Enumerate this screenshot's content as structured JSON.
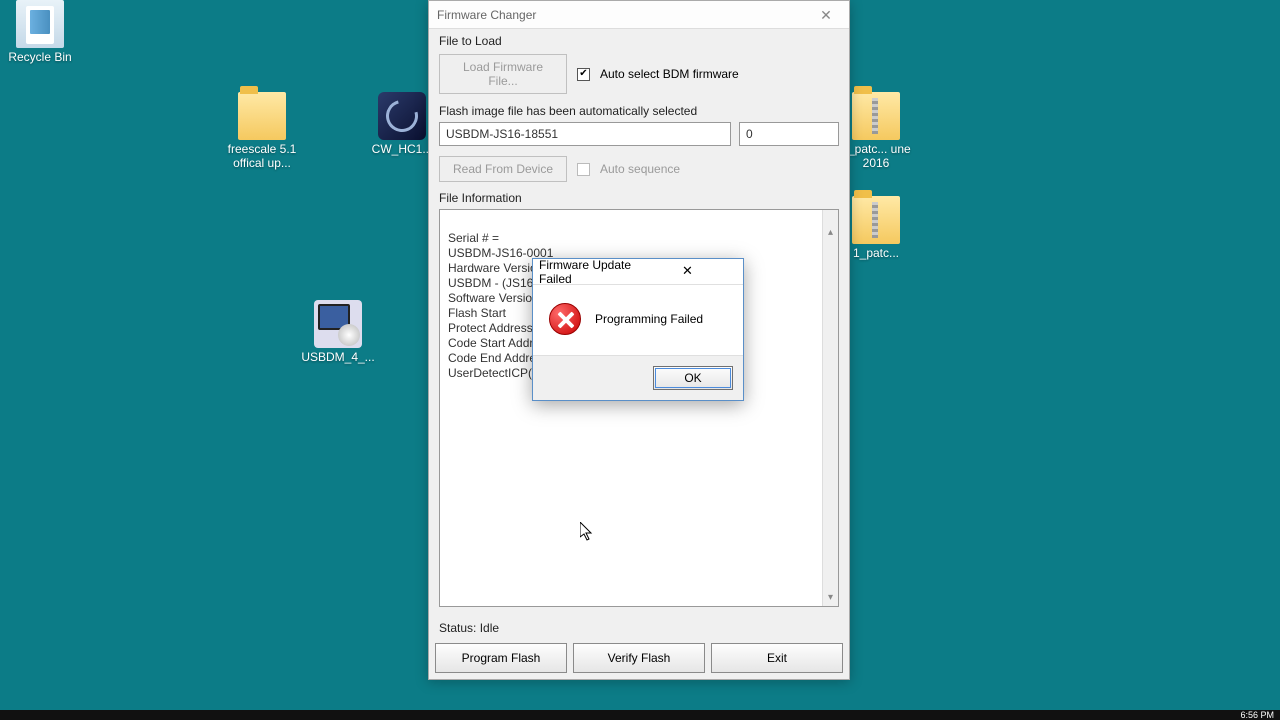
{
  "desktop": {
    "recycle_bin": "Recycle Bin",
    "freescale": "freescale 5.1 offical up...",
    "cw_hc1": "CW_HC1...",
    "usbdm": "USBDM_4_...",
    "patc1": "1_patc... une 2016",
    "patc2": "1_patc..."
  },
  "window": {
    "title": "Firmware Changer",
    "group1": "File to Load",
    "load_btn": "Load Firmware File...",
    "auto_select_label": "Auto select BDM firmware",
    "flash_msg": "Flash image file has been automatically selected",
    "device_value": "USBDM-JS16-18551",
    "offset_value": "0",
    "read_btn": "Read From Device",
    "auto_seq_label": "Auto sequence",
    "group2": "File Information",
    "info_text": "Serial # =\n USBDM-JS16-0001\nHardware Version =\n USBDM - (JS16C\nSoftware Version\nFlash Start\nProtect Address\nCode Start Addres\nCode End Address\nUserDetectICP()",
    "status": "Status: Idle",
    "program_btn": "Program Flash",
    "verify_btn": "Verify Flash",
    "exit_btn": "Exit"
  },
  "dialog": {
    "title": "Firmware Update Failed",
    "message": "Programming Failed",
    "ok": "OK"
  },
  "tray": {
    "time": "6:56 PM"
  }
}
